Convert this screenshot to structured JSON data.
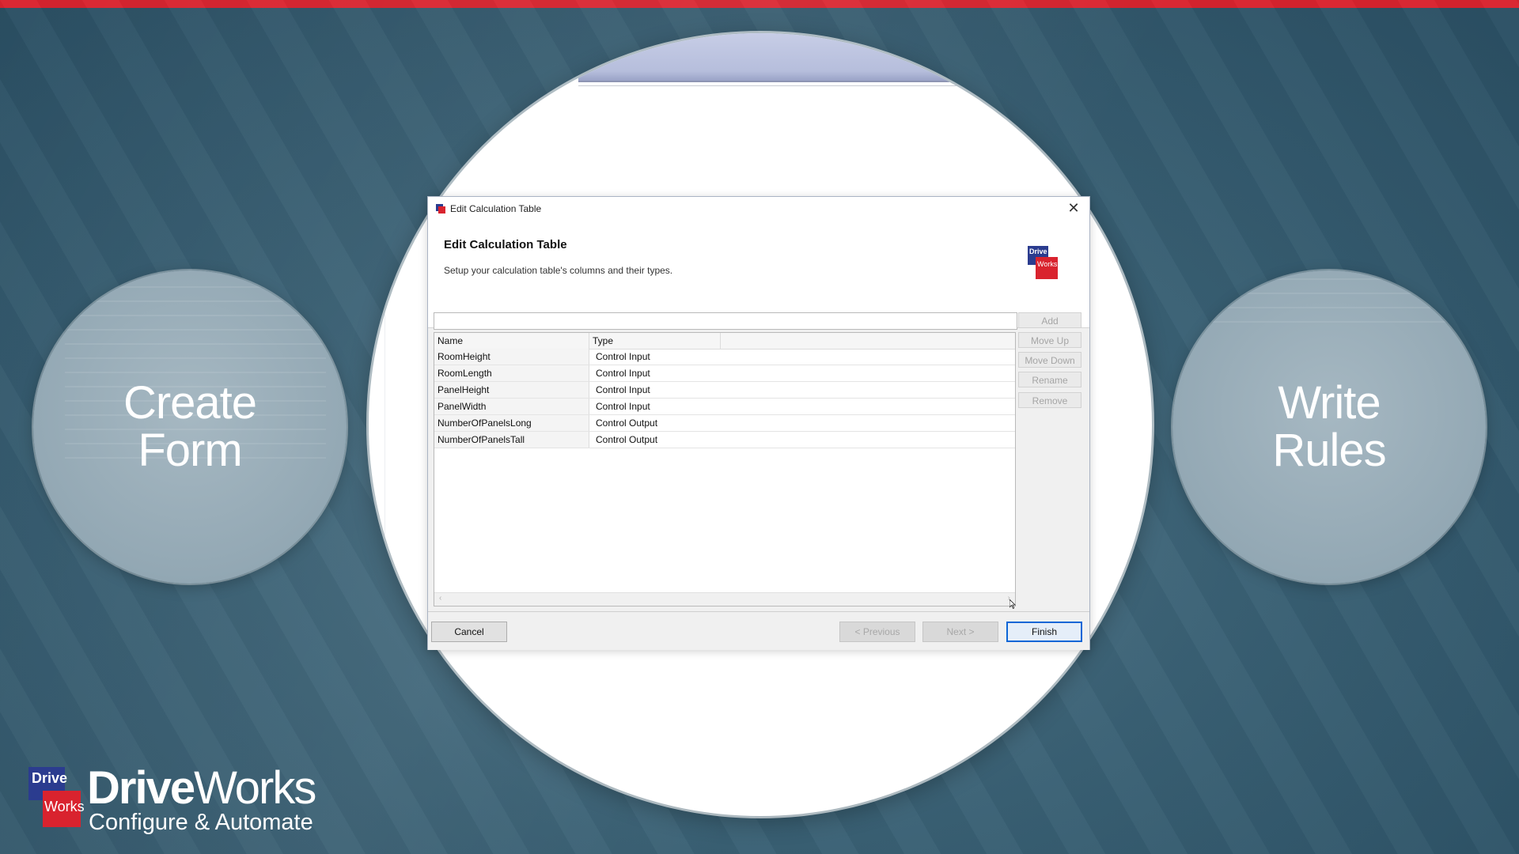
{
  "side_circles": {
    "left": {
      "line1": "Create",
      "line2": "Form"
    },
    "right": {
      "line1": "Write",
      "line2": "Rules"
    }
  },
  "dialog": {
    "window_title": "Edit Calculation Table",
    "heading": "Edit Calculation Table",
    "subheading": "Setup your calculation table's columns and their types.",
    "logo_top": "Drive",
    "logo_bottom": "Works",
    "name_input_value": "",
    "side_buttons": [
      "Add",
      "Move Up",
      "Move Down",
      "Rename",
      "Remove"
    ],
    "columns": [
      "Name",
      "Type"
    ],
    "rows": [
      {
        "name": "RoomHeight",
        "type": "Control Input"
      },
      {
        "name": "RoomLength",
        "type": "Control Input"
      },
      {
        "name": "PanelHeight",
        "type": "Control Input"
      },
      {
        "name": "PanelWidth",
        "type": "Control Input"
      },
      {
        "name": "NumberOfPanelsLong",
        "type": "Control Output"
      },
      {
        "name": "NumberOfPanelsTall",
        "type": "Control Output"
      }
    ],
    "footer": {
      "cancel": "Cancel",
      "previous": "< Previous",
      "next": "Next >",
      "finish": "Finish"
    }
  },
  "brand": {
    "mark_top": "Drive",
    "mark_bottom": "Works",
    "name_bold": "Drive",
    "name_light": "Works",
    "tagline": "Configure & Automate"
  },
  "colors": {
    "accent_red": "#d9232e",
    "brand_blue": "#2b3c8f",
    "focus_blue": "#0e66d6"
  }
}
